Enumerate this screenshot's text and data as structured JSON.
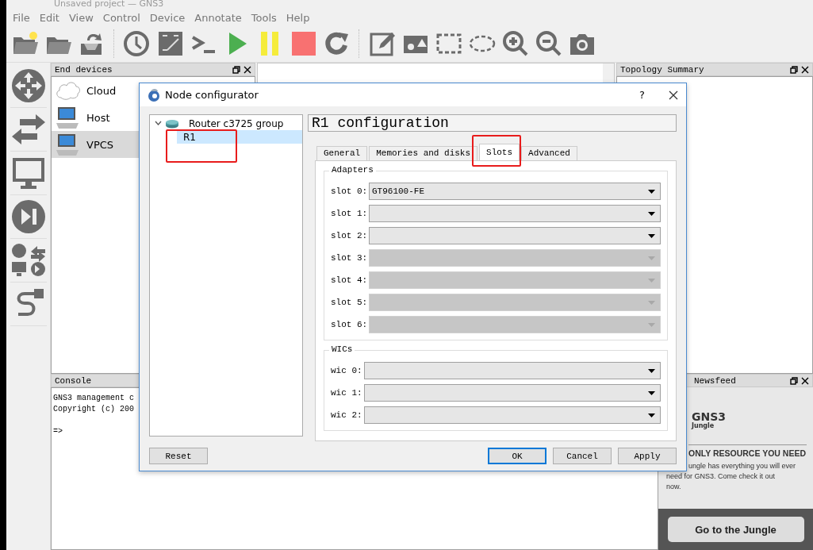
{
  "window": {
    "title": "Unsaved project — GNS3"
  },
  "menu": [
    {
      "label": "File"
    },
    {
      "label": "Edit"
    },
    {
      "label": "View"
    },
    {
      "label": "Control"
    },
    {
      "label": "Device"
    },
    {
      "label": "Annotate"
    },
    {
      "label": "Tools"
    },
    {
      "label": "Help"
    }
  ],
  "end_devices": {
    "title": "End devices",
    "items": [
      {
        "label": "Cloud",
        "kind": "cloud",
        "selected": false
      },
      {
        "label": "Host",
        "kind": "computer",
        "selected": false
      },
      {
        "label": "VPCS",
        "kind": "computer",
        "selected": true
      }
    ]
  },
  "topology_summary": {
    "title": "Topology Summary"
  },
  "console": {
    "title": "Console",
    "lines": [
      "GNS3 management c",
      "Copyright (c) 200"
    ],
    "prompt": "=>"
  },
  "newsfeed": {
    "title": "Newsfeed",
    "logo": "GNS3",
    "logo_sub": "Jungle",
    "headline": "ONLY RESOURCE YOU NEED",
    "lines": [
      "ungle has everything you will ever",
      "need for GNS3. Come check it out",
      "now."
    ],
    "button": "Go to the Jungle"
  },
  "dialog": {
    "title": "Node configurator",
    "help": "?",
    "tree": [
      {
        "label": "Router c3725 group",
        "expanded": true,
        "selected": false,
        "children": [
          {
            "label": "R1",
            "selected": true,
            "highlighted": true
          }
        ]
      }
    ],
    "heading": "R1 configuration",
    "tabs": [
      {
        "label": "General",
        "selected": false,
        "highlighted": false
      },
      {
        "label": "Memories and disks",
        "selected": false,
        "highlighted": false
      },
      {
        "label": "Slots",
        "selected": true,
        "highlighted": true
      },
      {
        "label": "Advanced",
        "selected": false,
        "highlighted": false
      }
    ],
    "groups": [
      {
        "title": "Adapters",
        "fields": [
          {
            "label": "slot 0:",
            "value": "GT96100-FE",
            "disabled": false
          },
          {
            "label": "slot 1:",
            "disabled": false
          },
          {
            "label": "slot 2:",
            "disabled": false
          },
          {
            "label": "slot 3:",
            "disabled": true
          },
          {
            "label": "slot 4:",
            "disabled": true
          },
          {
            "label": "slot 5:",
            "disabled": true
          },
          {
            "label": "slot 6:",
            "disabled": true
          }
        ]
      },
      {
        "title": "WICs",
        "fields": [
          {
            "label": "wic 0:",
            "disabled": false
          },
          {
            "label": "wic 1:",
            "disabled": false
          },
          {
            "label": "wic 2:",
            "disabled": false
          }
        ]
      }
    ],
    "buttons": [
      {
        "label": "Reset",
        "default": false
      },
      {
        "label": "OK",
        "default": true
      },
      {
        "label": "Cancel",
        "default": false
      },
      {
        "label": "Apply",
        "default": false
      }
    ]
  }
}
